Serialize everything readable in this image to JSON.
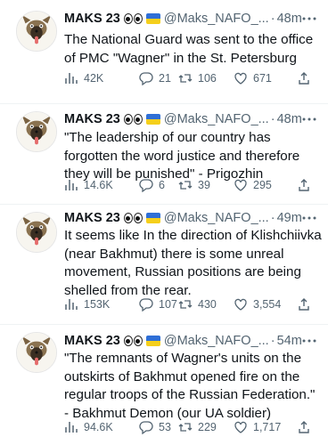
{
  "tweets": [
    {
      "name": "MAKS 23",
      "handle": "@Maks_NAFO_...",
      "sep": "·",
      "time": "48m",
      "text": "The National Guard was sent to the office of PMC \"Wagner\" in the St. Petersburg",
      "views": "42K",
      "replies": "21",
      "retweets": "106",
      "likes": "671"
    },
    {
      "name": "MAKS 23",
      "handle": "@Maks_NAFO_...",
      "sep": "·",
      "time": "48m",
      "text": "\"The leadership of our country has forgotten the word justice and therefore they will be punished\" - Prigozhin",
      "views": "14.6K",
      "replies": "6",
      "retweets": "39",
      "likes": "295"
    },
    {
      "name": "MAKS 23",
      "handle": "@Maks_NAFO_...",
      "sep": "·",
      "time": "49m",
      "text": "It seems like In the direction of Klishchiivka (near Bakhmut) there is some unreal movement, Russian positions are being shelled from the rear.",
      "views": "153K",
      "replies": "107",
      "retweets": "430",
      "likes": "3,554"
    },
    {
      "name": "MAKS 23",
      "handle": "@Maks_NAFO_...",
      "sep": "·",
      "time": "54m",
      "text": "\"The remnants of Wagner's units on the outskirts of Bakhmut opened fire on the regular troops of the Russian Federation.\" - Bakhmut Demon (our UA soldier)",
      "views": "94.6K",
      "replies": "53",
      "retweets": "229",
      "likes": "1,717"
    }
  ],
  "icons": {
    "avatar": "dog-meme-avatar",
    "emoji": "eyes-emoji",
    "flag": "ukraine-flag",
    "more": "more-dots-icon",
    "views": "views-bar-chart-icon",
    "reply": "reply-bubble-icon",
    "retweet": "retweet-icon",
    "like": "heart-icon",
    "share": "share-icon"
  },
  "colors": {
    "text": "#0f1419",
    "muted": "#536471",
    "flag_blue": "#2f6fd6",
    "flag_yellow": "#f5cf1b"
  }
}
